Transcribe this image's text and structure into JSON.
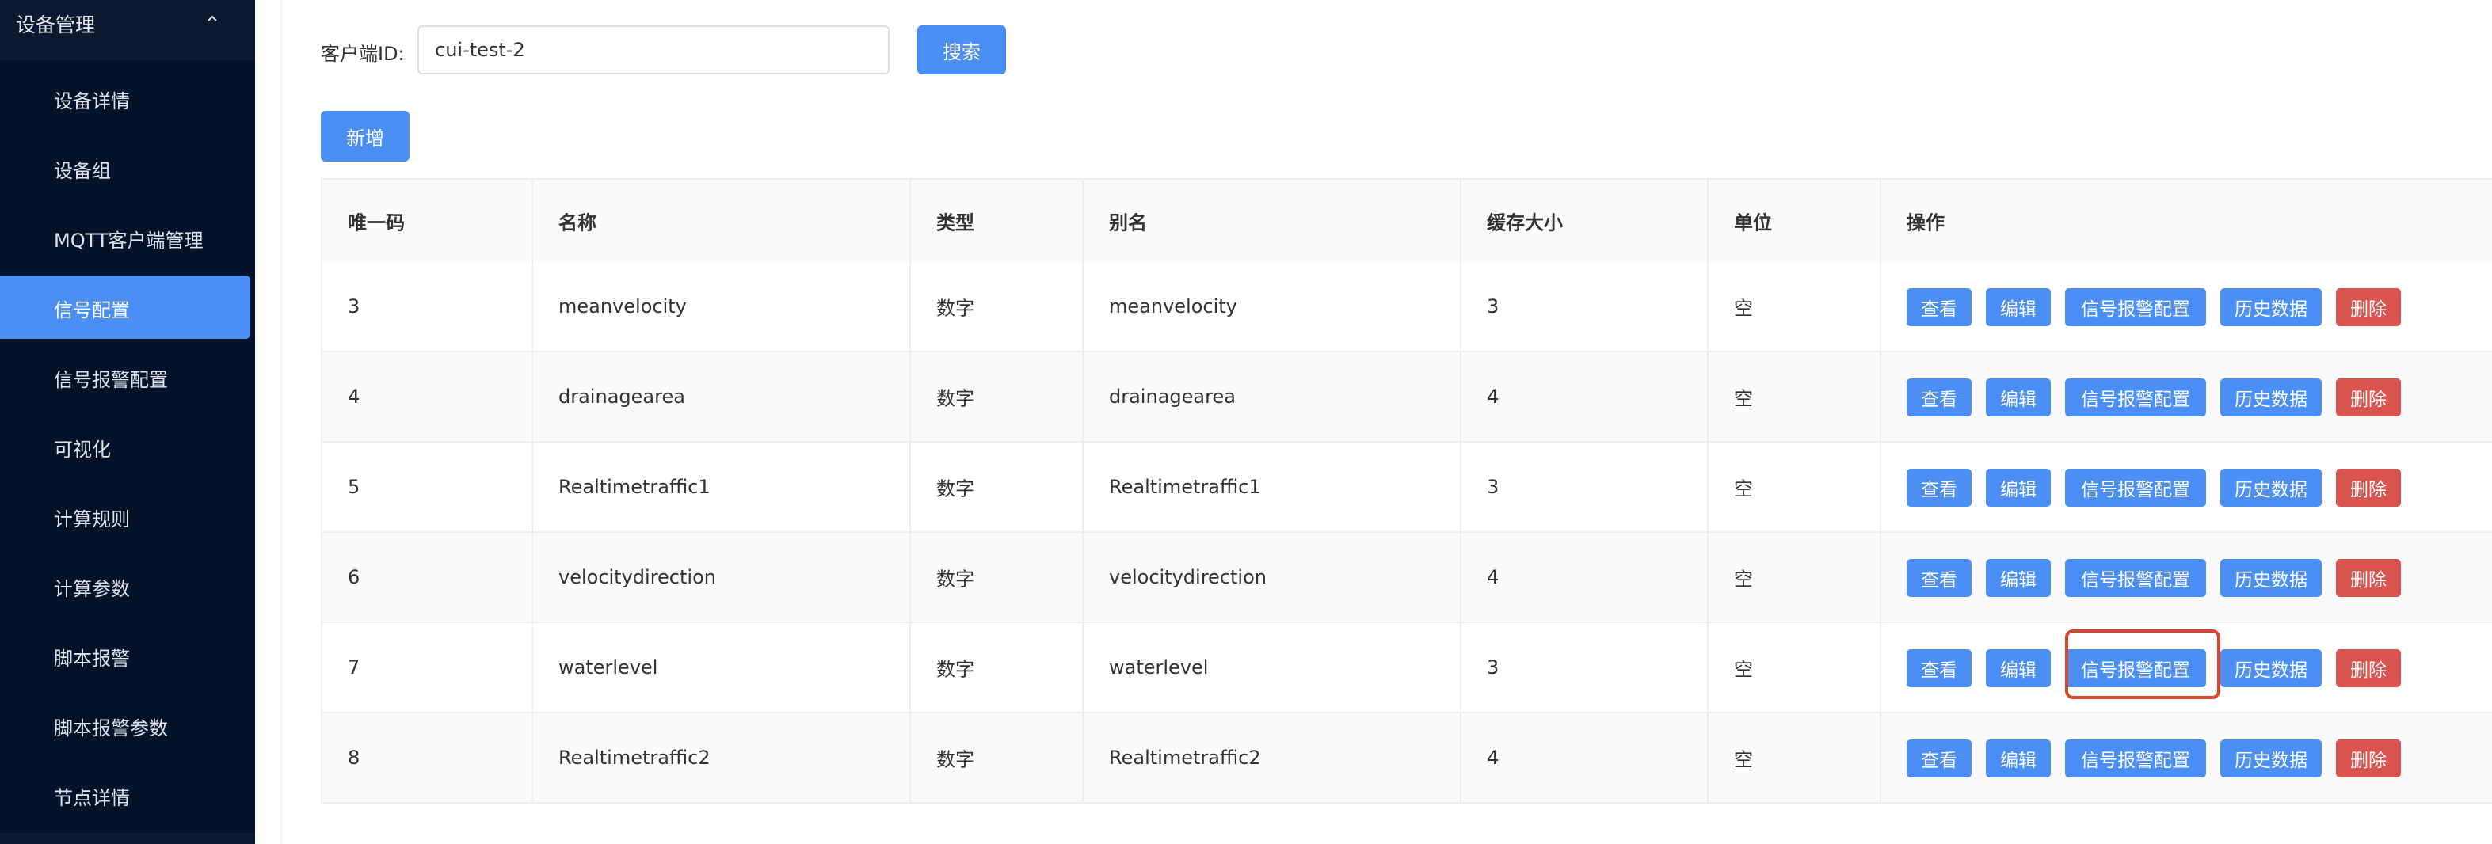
{
  "sidebar": {
    "group_title": "设备管理",
    "items": [
      {
        "label": "设备详情",
        "active": false
      },
      {
        "label": "设备组",
        "active": false
      },
      {
        "label": "MQTT客户端管理",
        "active": false
      },
      {
        "label": "信号配置",
        "active": true
      },
      {
        "label": "信号报警配置",
        "active": false
      },
      {
        "label": "可视化",
        "active": false
      },
      {
        "label": "计算规则",
        "active": false
      },
      {
        "label": "计算参数",
        "active": false
      },
      {
        "label": "脚本报警",
        "active": false
      },
      {
        "label": "脚本报警参数",
        "active": false
      },
      {
        "label": "节点详情",
        "active": false
      }
    ]
  },
  "search": {
    "label": "客户端ID:",
    "value": "cui-test-2",
    "button": "搜索"
  },
  "toolbar": {
    "add_label": "新增"
  },
  "table": {
    "columns": [
      "唯一码",
      "名称",
      "类型",
      "别名",
      "缓存大小",
      "单位",
      "操作"
    ],
    "actions": {
      "view": "查看",
      "edit": "编辑",
      "alarm": "信号报警配置",
      "history": "历史数据",
      "delete": "删除"
    },
    "rows": [
      {
        "id": "3",
        "name": "meanvelocity",
        "type": "数字",
        "alias": "meanvelocity",
        "cache": "3",
        "unit": "空"
      },
      {
        "id": "4",
        "name": "drainagearea",
        "type": "数字",
        "alias": "drainagearea",
        "cache": "4",
        "unit": "空"
      },
      {
        "id": "5",
        "name": "Realtimetraffic1",
        "type": "数字",
        "alias": "Realtimetraffic1",
        "cache": "3",
        "unit": "空"
      },
      {
        "id": "6",
        "name": "velocitydirection",
        "type": "数字",
        "alias": "velocitydirection",
        "cache": "4",
        "unit": "空"
      },
      {
        "id": "7",
        "name": "waterlevel",
        "type": "数字",
        "alias": "waterlevel",
        "cache": "3",
        "unit": "空"
      },
      {
        "id": "8",
        "name": "Realtimetraffic2",
        "type": "数字",
        "alias": "Realtimetraffic2",
        "cache": "4",
        "unit": "空"
      }
    ]
  },
  "colors": {
    "primary": "#4b8ef4",
    "danger": "#d9534f",
    "sidebar_bg": "#04132a",
    "highlight": "#d9452c"
  }
}
